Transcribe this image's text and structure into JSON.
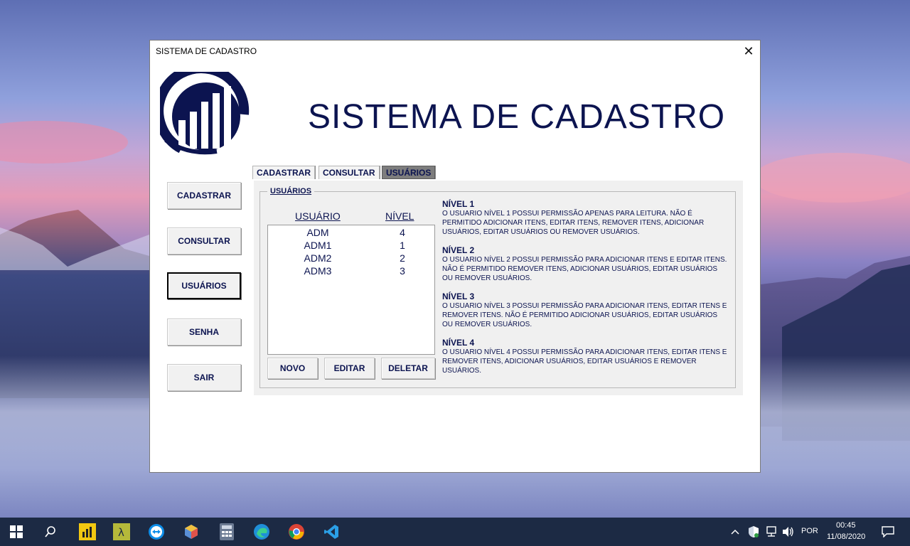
{
  "window": {
    "title": "SISTEMA DE CADASTRO",
    "app_title": "SISTEMA DE CADASTRO"
  },
  "sidebar": {
    "buttons": [
      {
        "label": "CADASTRAR"
      },
      {
        "label": "CONSULTAR"
      },
      {
        "label": "USUÁRIOS",
        "active": true
      },
      {
        "label": "SENHA"
      },
      {
        "label": "SAIR"
      }
    ]
  },
  "tabs": [
    {
      "label": "CADASTRAR"
    },
    {
      "label": "CONSULTAR"
    },
    {
      "label": "USUÁRIOS",
      "active": true
    }
  ],
  "users_panel": {
    "group_label": "USUÁRIOS",
    "col_user": "USUÁRIO",
    "col_level": "NÍVEL",
    "rows": [
      {
        "user": "ADM",
        "level": "4"
      },
      {
        "user": "ADM1",
        "level": "1"
      },
      {
        "user": "ADM2",
        "level": "2"
      },
      {
        "user": "ADM3",
        "level": "3"
      }
    ],
    "btn_new": "NOVO",
    "btn_edit": "EDITAR",
    "btn_delete": "DELETAR"
  },
  "levels": [
    {
      "title": "NÍVEL 1",
      "desc": "O USUARIO NÍVEL 1 POSSUI PERMISSÃO APENAS PARA LEITURA. NÃO É PERMITIDO ADICIONAR ITENS, EDITAR ITENS, REMOVER ITENS, ADICIONAR USUÁRIOS, EDITAR USUÁRIOS OU REMOVER USUÁRIOS."
    },
    {
      "title": "NÍVEL 2",
      "desc": "O USUARIO NÍVEL 2 POSSUI PERMISSÃO PARA ADICIONAR ITENS E EDITAR ITENS. NÃO É PERMITIDO REMOVER ITENS, ADICIONAR USUÁRIOS, EDITAR USUÁRIOS OU REMOVER USUÁRIOS."
    },
    {
      "title": "NÍVEL 3",
      "desc": "O USUARIO NÍVEL 3 POSSUI PERMISSÃO PARA ADICIONAR ITENS, EDITAR ITENS E REMOVER ITENS. NÃO É PERMITIDO ADICIONAR USUÁRIOS, EDITAR USUÁRIOS OU REMOVER USUÁRIOS."
    },
    {
      "title": "NÍVEL 4",
      "desc": "O USUARIO NÍVEL 4 POSSUI PERMISSÃO PARA ADICIONAR ITENS, EDITAR ITENS E REMOVER ITENS, ADICIONAR USUÁRIOS, EDITAR USUÁRIOS E REMOVER USUÁRIOS."
    }
  ],
  "taskbar": {
    "icons": [
      "windows-start-icon",
      "search-icon",
      "power-bi-icon",
      "lambda-app-icon",
      "teamviewer-icon",
      "box-app-icon",
      "calculator-icon",
      "edge-icon",
      "chrome-icon",
      "vscode-icon"
    ],
    "language": "POR",
    "time": "00:45",
    "date": "11/08/2020"
  },
  "colors": {
    "navy": "#0c1450",
    "active_tab": "#7d7d7d",
    "taskbar": "#1c2a44"
  }
}
